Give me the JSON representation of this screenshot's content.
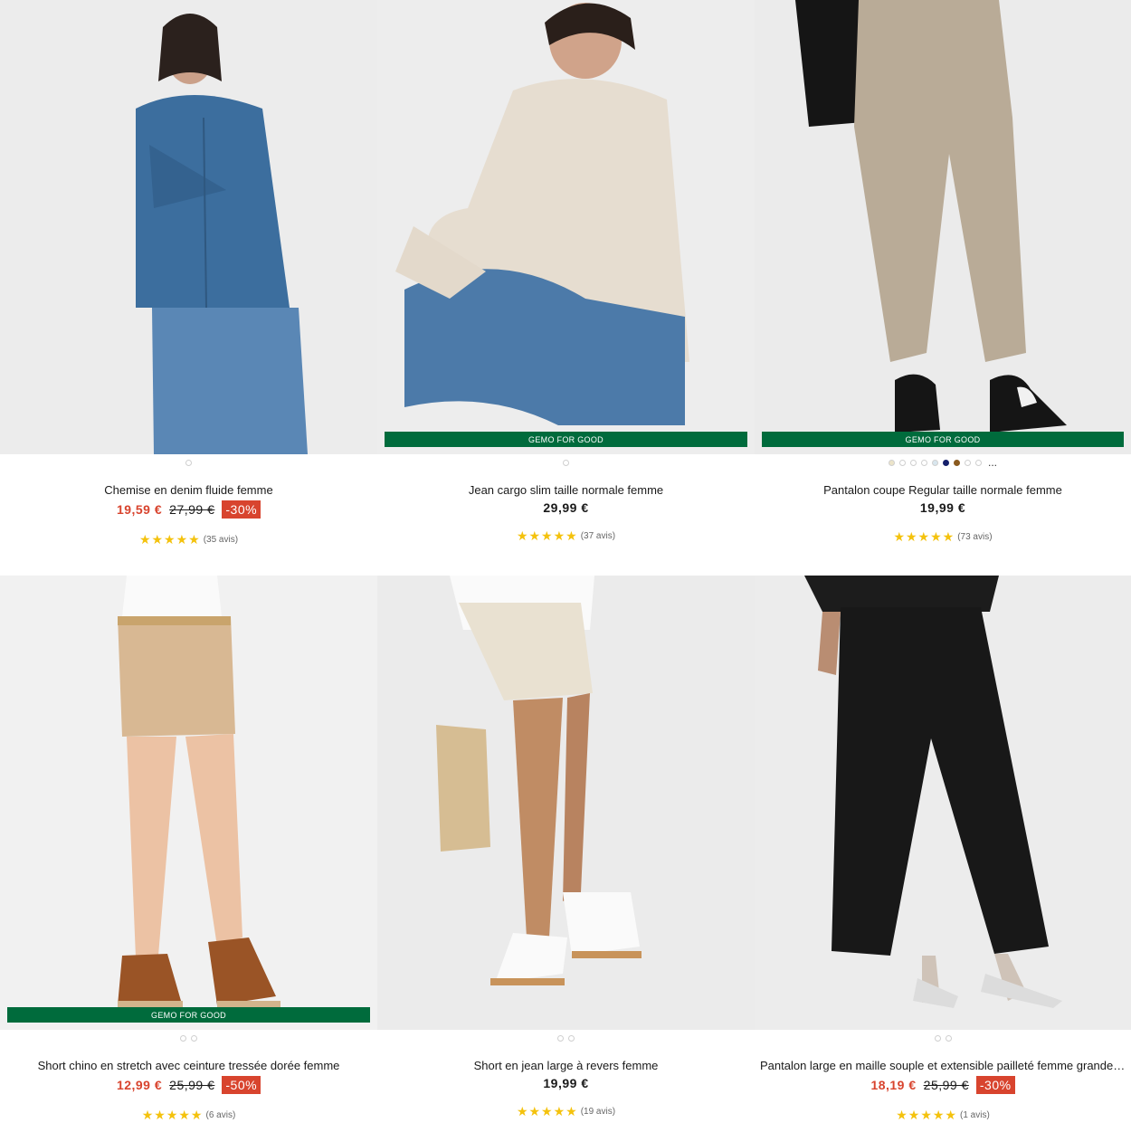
{
  "colors": {
    "sale": "#d8442e",
    "badge": "#006b3c",
    "star": "#f4c20d"
  },
  "products": [
    {
      "name": "Chemise en denim fluide femme",
      "price": "19,59 €",
      "old_price": "27,99 €",
      "discount": "-30%",
      "stars": "★★★★★",
      "reviews": "(35 avis)",
      "badge": ""
    },
    {
      "name": "Jean cargo slim taille normale femme",
      "price": "29,99 €",
      "stars": "★★★★★",
      "reviews": "(37 avis)",
      "badge": "GEMO FOR GOOD"
    },
    {
      "name": "Pantalon coupe Regular taille normale femme",
      "price": "19,99 €",
      "stars": "★★★★★",
      "reviews": "(73 avis)",
      "badge": "GEMO FOR GOOD",
      "more_colors": "..."
    },
    {
      "name": "Short chino en stretch avec ceinture tressée dorée femme",
      "price": "12,99 €",
      "old_price": "25,99 €",
      "discount": "-50%",
      "stars": "★★★★★",
      "reviews": "(6 avis)",
      "badge": "GEMO FOR GOOD"
    },
    {
      "name": "Short en jean large à revers femme",
      "price": "19,99 €",
      "stars": "★★★★★",
      "reviews": "(19 avis)",
      "badge": ""
    },
    {
      "name": "Pantalon large en maille souple et extensible pailleté femme grande taille",
      "price": "18,19 €",
      "old_price": "25,99 €",
      "discount": "-30%",
      "stars": "★★★★★",
      "reviews": "(1 avis)",
      "badge": ""
    }
  ]
}
